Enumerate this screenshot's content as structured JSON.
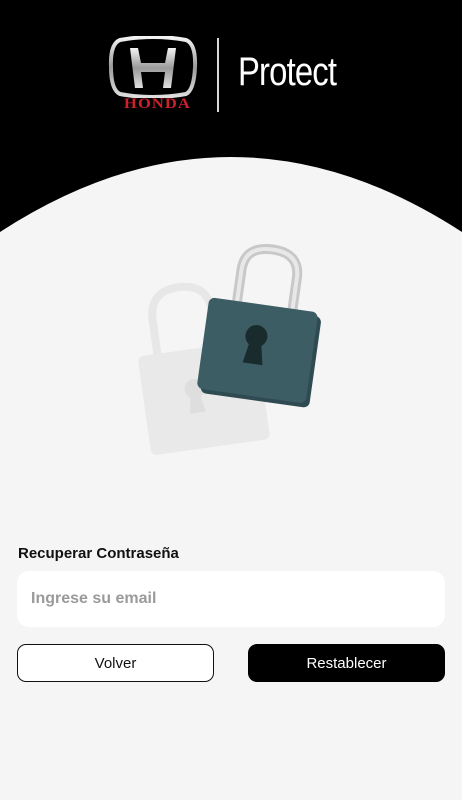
{
  "brand": {
    "logo_text": "HONDA",
    "product": "Protect"
  },
  "form": {
    "title": "Recuperar Contraseña",
    "email_placeholder": "Ingrese su email",
    "email_value": "",
    "back_label": "Volver",
    "reset_label": "Restablecer"
  },
  "colors": {
    "header": "#000000",
    "background": "#f5f5f5",
    "lock_body": "#3c5d64",
    "brand_red": "#d01f2f"
  },
  "icons": {
    "hero": "padlock-icon",
    "ghost": "padlock-outline-icon"
  }
}
